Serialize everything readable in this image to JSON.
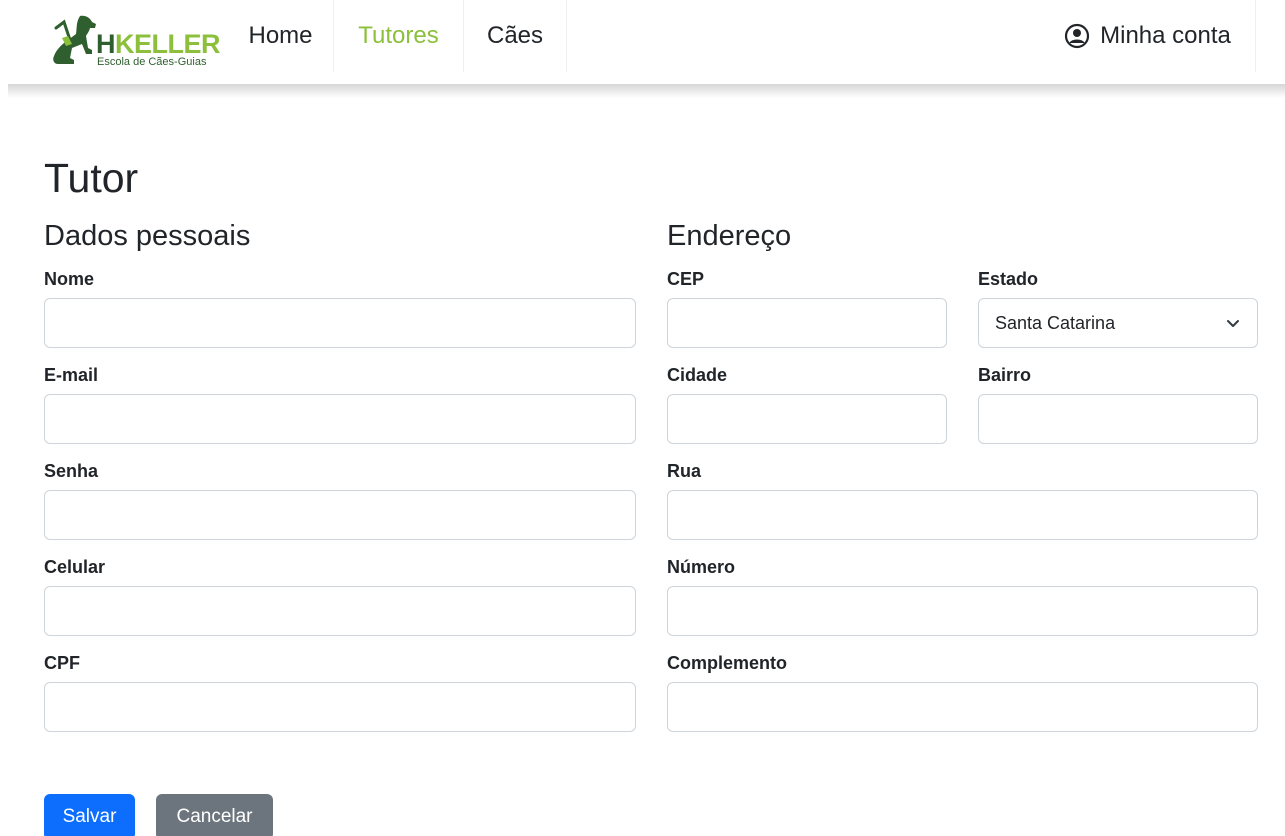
{
  "navbar": {
    "logo": {
      "brand": "HKELLER",
      "brand_h": "H",
      "brand_rest": "KELLER",
      "subtitle": "Escola de Cães-Guias",
      "icon": "guide-dog-icon"
    },
    "links": [
      {
        "label": "Home",
        "active": false
      },
      {
        "label": "Tutores",
        "active": true
      },
      {
        "label": "Cães",
        "active": false
      }
    ],
    "account": {
      "label": "Minha conta",
      "icon": "user-circle-icon"
    }
  },
  "colors": {
    "brand_green": "#8cc03c",
    "brand_dark": "#2f5f2e",
    "primary": "#0d6efd",
    "secondary": "#6c757d"
  },
  "form": {
    "title": "Tutor",
    "personal": {
      "heading": "Dados pessoais",
      "fields": {
        "nome": {
          "label": "Nome",
          "value": ""
        },
        "email": {
          "label": "E-mail",
          "value": ""
        },
        "senha": {
          "label": "Senha",
          "value": ""
        },
        "celular": {
          "label": "Celular",
          "value": ""
        },
        "cpf": {
          "label": "CPF",
          "value": ""
        }
      }
    },
    "address": {
      "heading": "Endereço",
      "fields": {
        "cep": {
          "label": "CEP",
          "value": ""
        },
        "estado": {
          "label": "Estado",
          "value": "Santa Catarina"
        },
        "cidade": {
          "label": "Cidade",
          "value": ""
        },
        "bairro": {
          "label": "Bairro",
          "value": ""
        },
        "rua": {
          "label": "Rua",
          "value": ""
        },
        "numero": {
          "label": "Número",
          "value": ""
        },
        "complemento": {
          "label": "Complemento",
          "value": ""
        }
      }
    },
    "buttons": {
      "save": "Salvar",
      "cancel": "Cancelar"
    }
  }
}
